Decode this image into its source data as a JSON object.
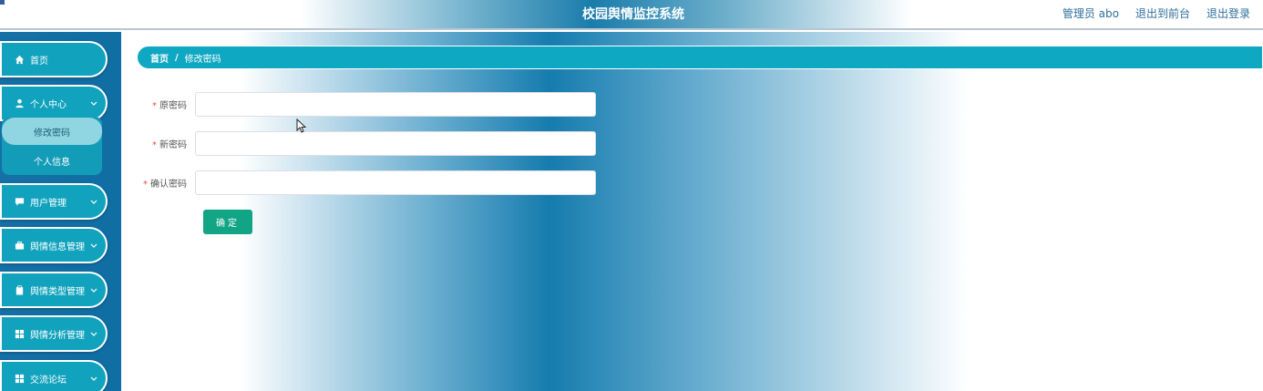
{
  "header": {
    "title": "校园舆情监控系统",
    "admin_label": "管理员 abo",
    "exit_front_label": "退出到前台",
    "logout_label": "退出登录"
  },
  "sidebar": {
    "items": [
      {
        "label": "首页",
        "icon": "home-icon"
      },
      {
        "label": "个人中心",
        "icon": "user-icon"
      },
      {
        "label": "用户管理",
        "icon": "chat-icon"
      },
      {
        "label": "舆情信息管理",
        "icon": "briefcase-icon"
      },
      {
        "label": "舆情类型管理",
        "icon": "clipboard-icon"
      },
      {
        "label": "舆情分析管理",
        "icon": "grid-icon"
      },
      {
        "label": "交流论坛",
        "icon": "grid-icon"
      }
    ],
    "submenu": [
      {
        "label": "修改密码",
        "active": true
      },
      {
        "label": "个人信息",
        "active": false
      }
    ]
  },
  "breadcrumb": {
    "home": "首页",
    "separator": "/",
    "current": "修改密码"
  },
  "form": {
    "required_mark": "*",
    "fields": [
      {
        "label": "原密码",
        "value": ""
      },
      {
        "label": "新密码",
        "value": ""
      },
      {
        "label": "确认密码",
        "value": ""
      }
    ],
    "submit_label": "确定"
  },
  "colors": {
    "sidebar_item": "#11a3bd",
    "sidebar_bg": "#1570a6",
    "breadcrumb_bg": "#0fa8c2",
    "submit_bg": "#12a585",
    "required": "#e5533f"
  }
}
